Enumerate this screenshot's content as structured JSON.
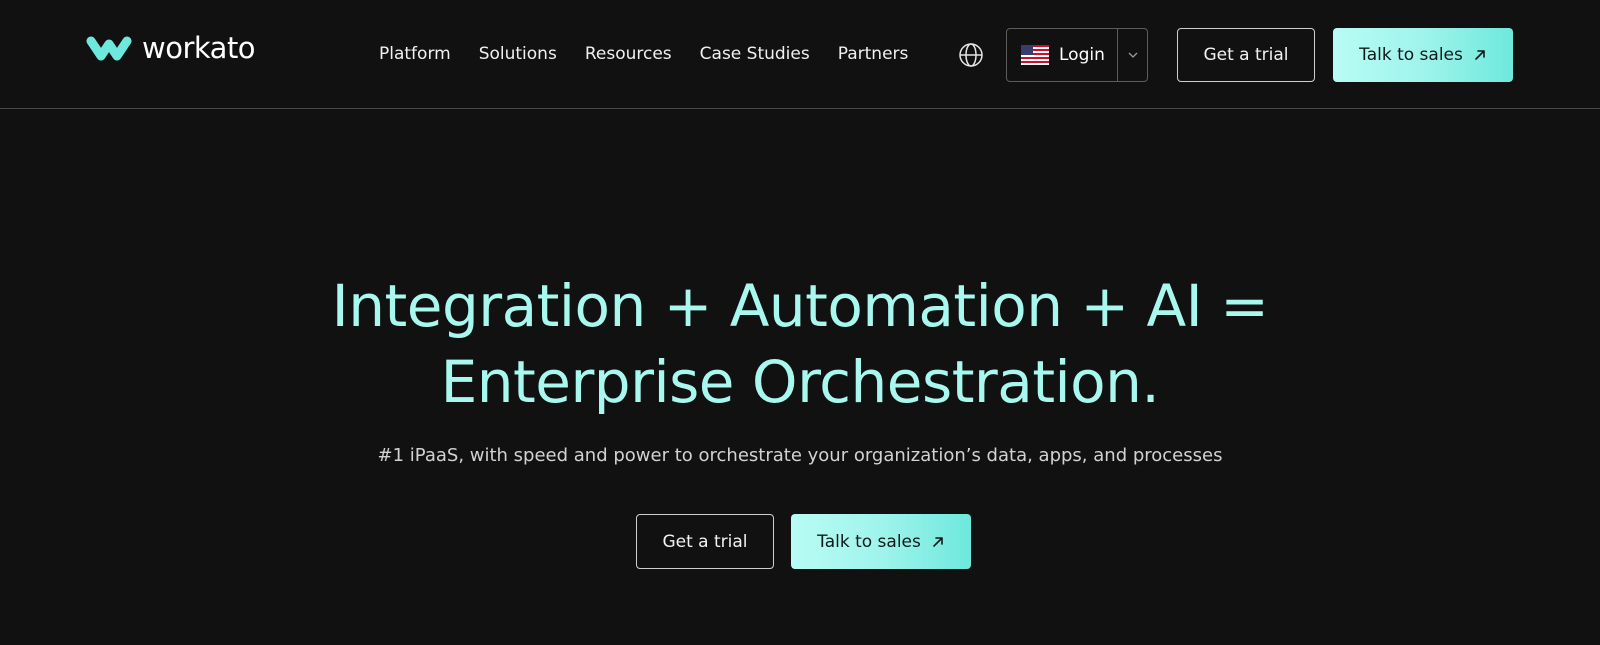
{
  "brand": {
    "name": "workato",
    "accent": "#a8f8ef",
    "logo_icon": "workato-logo-icon"
  },
  "nav": {
    "items": [
      {
        "label": "Platform"
      },
      {
        "label": "Solutions"
      },
      {
        "label": "Resources"
      },
      {
        "label": "Case Studies"
      },
      {
        "label": "Partners"
      }
    ],
    "globe_icon": "globe-icon"
  },
  "header": {
    "login_label": "Login",
    "login_flag_icon": "us-flag-icon",
    "login_caret_icon": "chevron-down-icon",
    "trial_label": "Get a trial",
    "sales_label": "Talk to sales",
    "sales_icon": "arrow-up-right-icon"
  },
  "hero": {
    "title_line1": "Integration + Automation + AI =",
    "title_line2": "Enterprise Orchestration.",
    "subtitle": "#1 iPaaS, with speed and power to orchestrate your organization’s data, apps, and processes",
    "trial_label": "Get a trial",
    "sales_label": "Talk to sales"
  },
  "colors": {
    "background": "#111111",
    "title": "#a8f8ef",
    "button_gradient_start": "#b8fcf4",
    "button_gradient_end": "#6ee8dc"
  }
}
